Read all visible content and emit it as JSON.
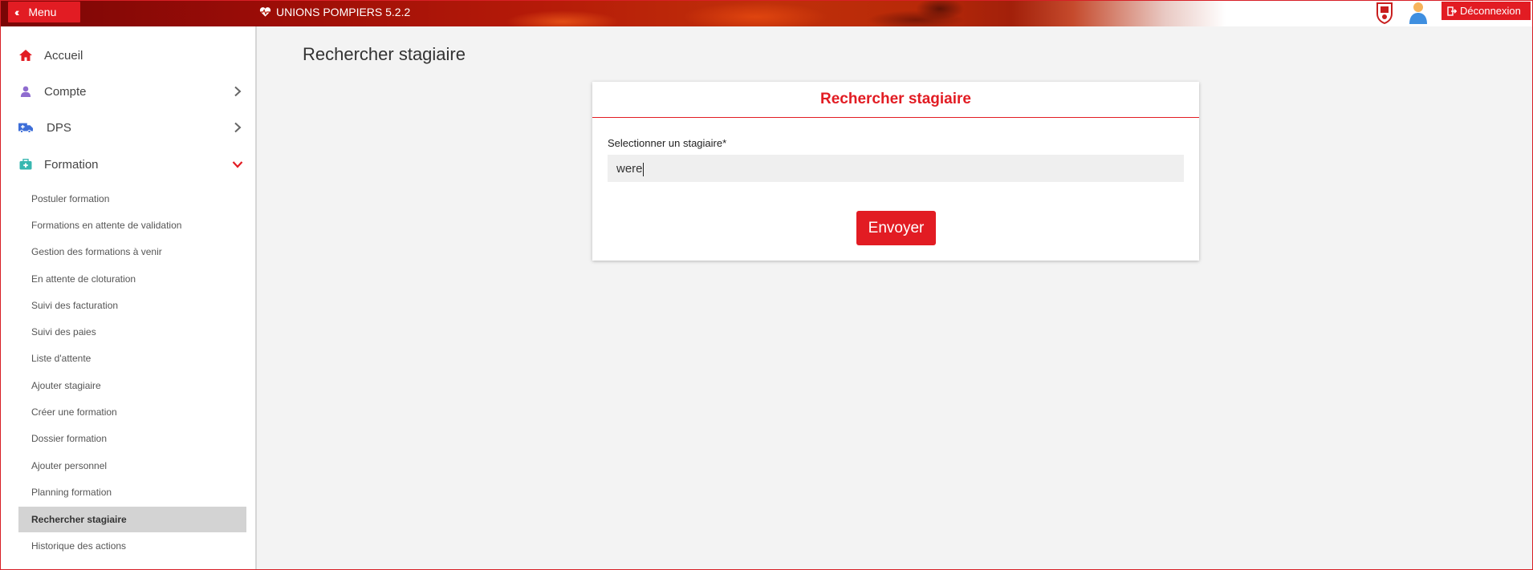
{
  "topbar": {
    "menu_label": "Menu",
    "app_title": "UNIONS POMPIERS 5.2.2",
    "logout_label": "Déconnexion",
    "accent_color": "#e21c23"
  },
  "sidebar": {
    "main_items": [
      {
        "label": "Accueil",
        "icon": "home-icon",
        "color": "#e21c23"
      },
      {
        "label": "Compte",
        "icon": "user-icon",
        "color": "#8f6ccf",
        "arrow": "chevron-right-icon"
      },
      {
        "label": "DPS",
        "icon": "ambulance-icon",
        "color": "#3d6ed8",
        "arrow": "chevron-right-icon"
      },
      {
        "label": "Formation",
        "icon": "medkit-icon",
        "color": "#38b7b0",
        "arrow": "chevron-down-icon"
      }
    ],
    "sub_items": [
      {
        "label": "Postuler formation"
      },
      {
        "label": "Formations en attente de validation"
      },
      {
        "label": "Gestion des formations à venir"
      },
      {
        "label": "En attente de cloturation"
      },
      {
        "label": "Suivi des facturation"
      },
      {
        "label": "Suivi des paies"
      },
      {
        "label": "Liste d'attente"
      },
      {
        "label": "Ajouter stagiaire"
      },
      {
        "label": "Créer une formation"
      },
      {
        "label": "Dossier formation"
      },
      {
        "label": "Ajouter personnel"
      },
      {
        "label": "Planning formation"
      },
      {
        "label": "Rechercher stagiaire",
        "active": true
      },
      {
        "label": "Historique des actions"
      }
    ]
  },
  "main": {
    "page_title": "Rechercher stagiaire",
    "card": {
      "title": "Rechercher stagiaire",
      "field_label": "Selectionner un stagiaire*",
      "field_value": "were",
      "submit_label": "Envoyer"
    }
  }
}
